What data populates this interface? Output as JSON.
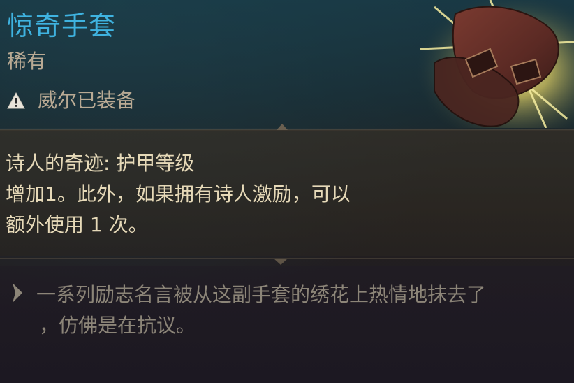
{
  "item": {
    "name": "惊奇手套",
    "rarity": "稀有",
    "equipped_by": "威尔已装备"
  },
  "effect": {
    "lines": [
      "诗人的奇迹: 护甲等级",
      "增加1。此外，如果拥有诗人激励，可以",
      "额外使用 1 次。"
    ]
  },
  "flavor": {
    "lines": [
      "一系列励志名言被从这副手套的绣花上热情地抹去了",
      "，仿佛是在抗议。"
    ]
  },
  "icons": {
    "equipped": "warning-icon",
    "flavor": "quote-chevron-icon",
    "item": "gloves-icon"
  },
  "colors": {
    "title": "#3fb3e0",
    "rarity": "#b9aa94",
    "effect_text": "#e6d9b8",
    "flavor_text": "#8c8578"
  }
}
